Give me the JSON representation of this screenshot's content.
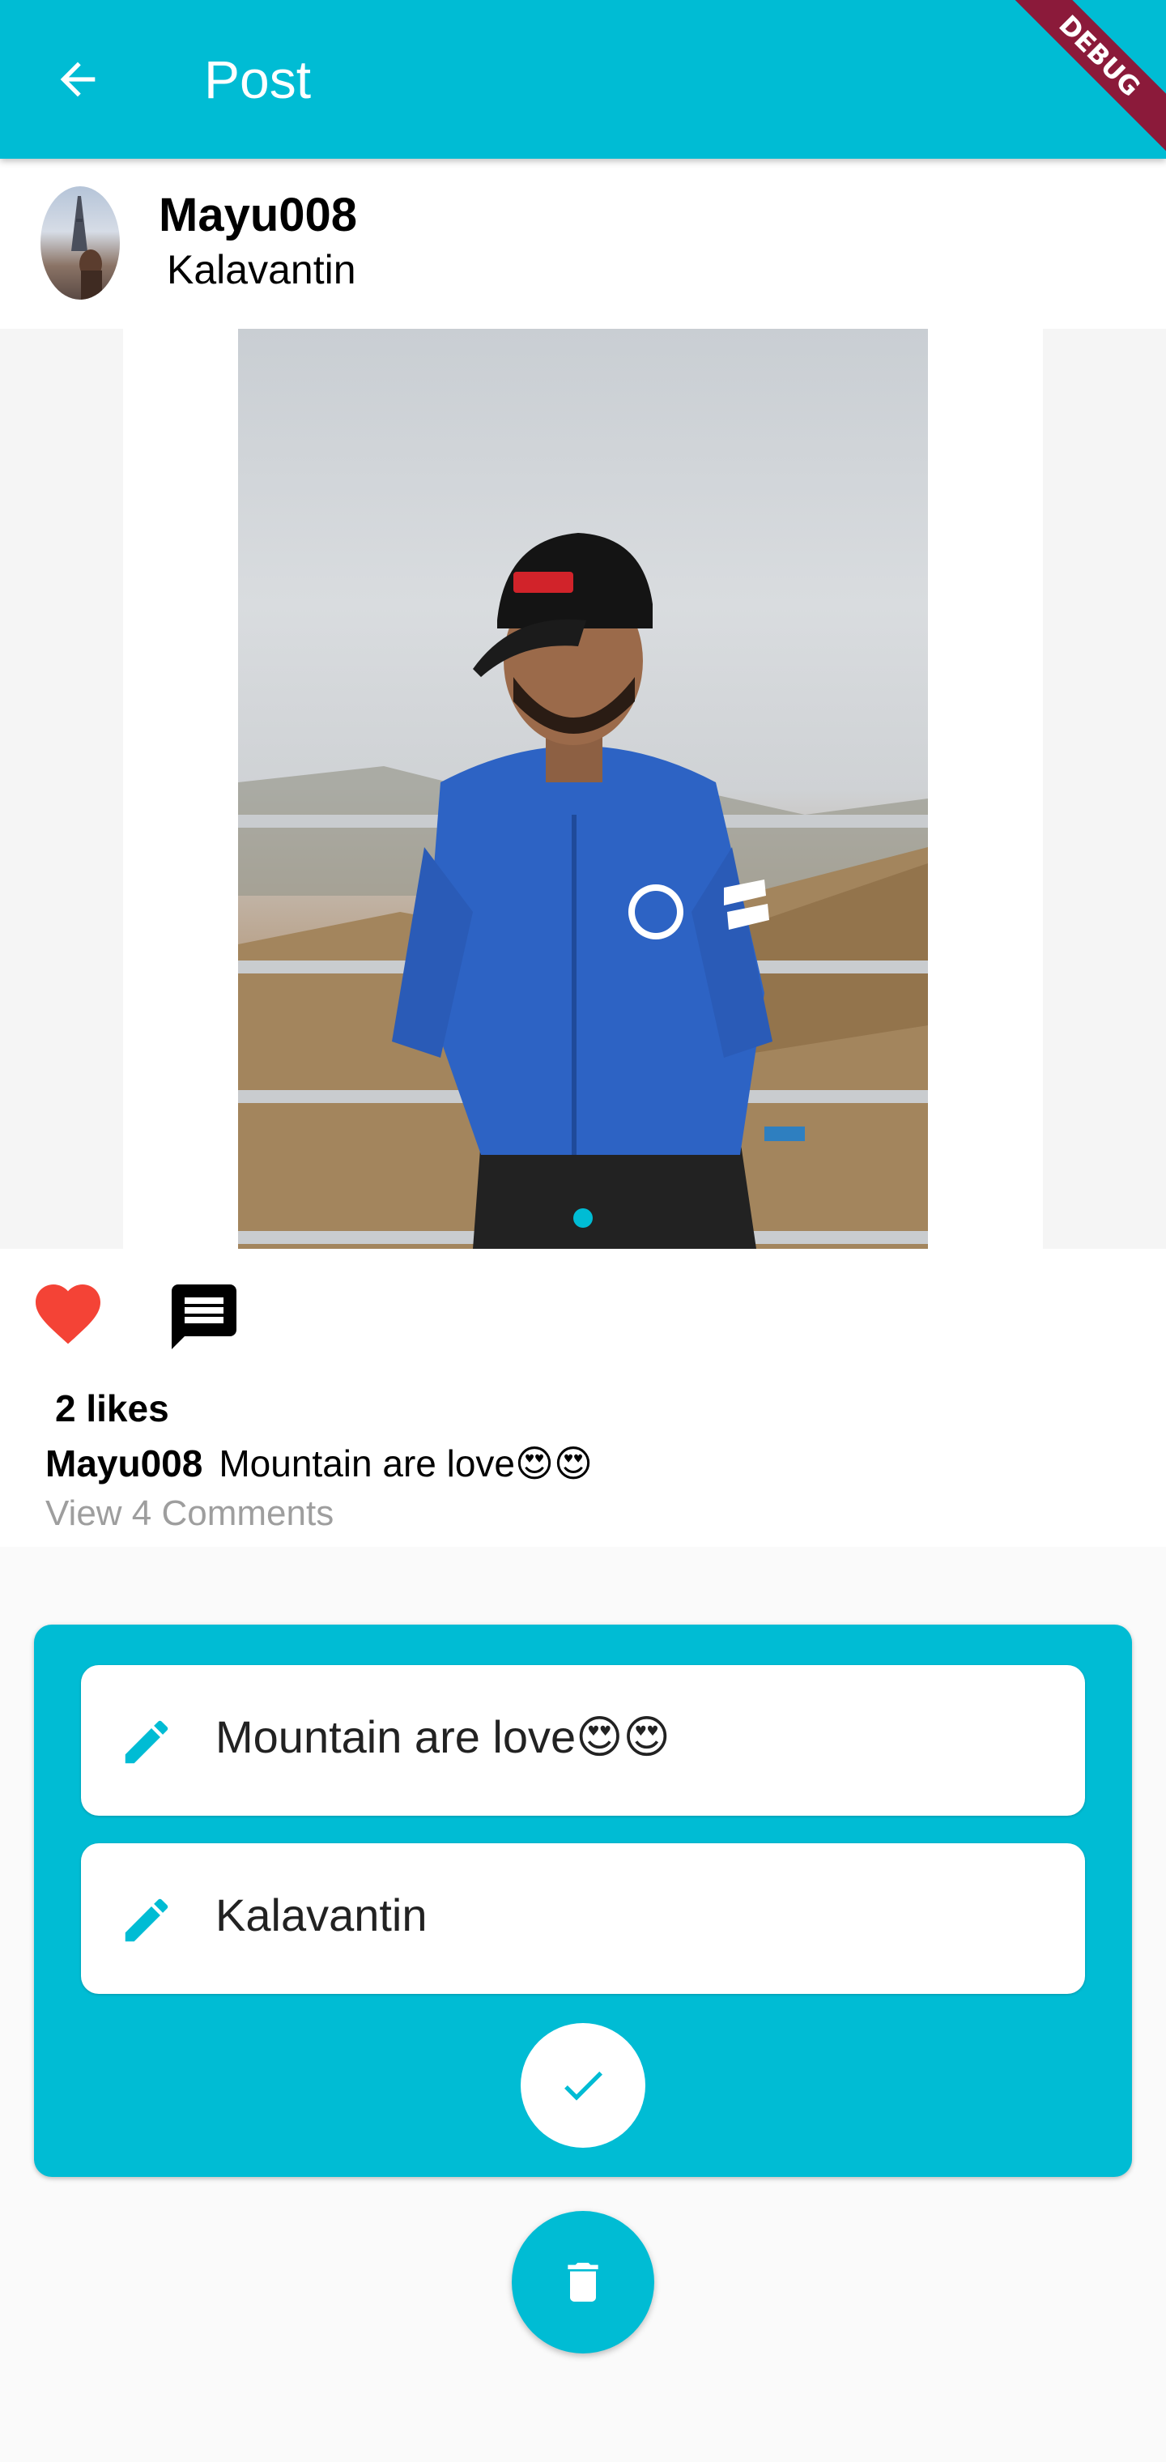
{
  "appbar": {
    "title": "Post",
    "debug_label": "DEBUG",
    "background": "#00BCD4"
  },
  "post": {
    "username": "Mayu008",
    "location": "Kalavantin",
    "likes_text": "2 likes",
    "caption_user": "Mayu008",
    "caption_text": "Mountain are love😍😍",
    "view_comments": "View 4 Comments",
    "liked": true
  },
  "edit": {
    "caption_value": "Mountain are love😍😍",
    "location_value": "Kalavantin"
  },
  "icons": {
    "back": "arrow-left-icon",
    "heart": "heart-icon",
    "comment": "comment-icon",
    "pencil": "pencil-icon",
    "check": "check-icon",
    "delete": "trash-icon"
  },
  "colors": {
    "accent": "#00BCD4",
    "heart": "#F44336",
    "debug": "#8B1A3A"
  }
}
